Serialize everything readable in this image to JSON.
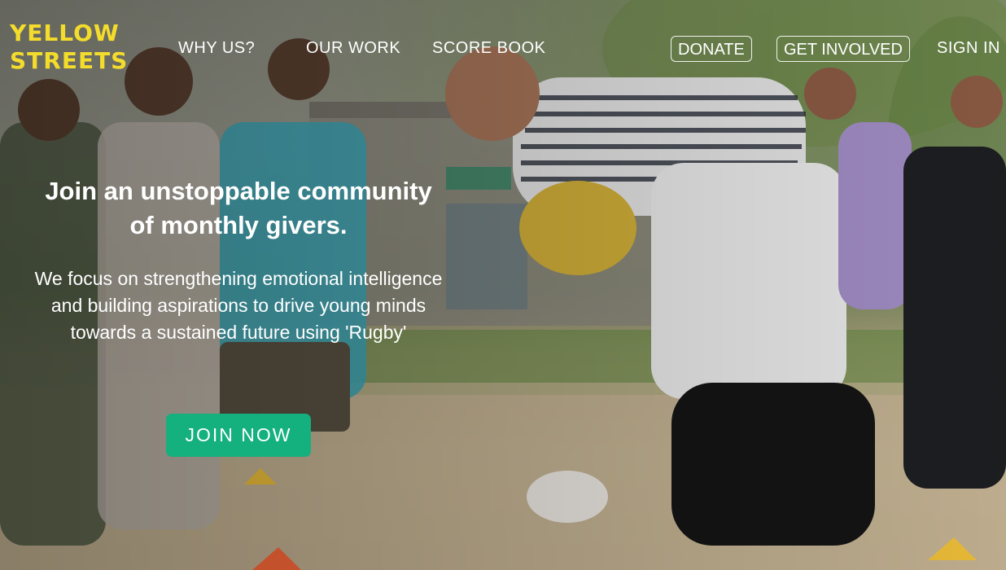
{
  "brand": {
    "logo_line1": "YELLOW",
    "logo_line2": "STREETS",
    "logo_color": "#f4dc2c"
  },
  "nav": {
    "links": [
      "WHY US?",
      "OUR WORK",
      "SCORE BOOK"
    ],
    "donate_label": "DONATE",
    "get_involved_label": "GET INVOLVED",
    "sign_in_label": "SIGN IN"
  },
  "hero": {
    "headline_line1": "Join an unstoppable community",
    "headline_line2": "of monthly givers.",
    "sub_line1": "We focus on strengthening emotional intelligence",
    "sub_line2": "and building aspirations to drive young minds",
    "sub_line3": "towards a sustained future using 'Rugby'",
    "cta_label": "JOIN NOW",
    "cta_color": "#14b07d",
    "background_image": "youth-rugby-training-photo"
  }
}
